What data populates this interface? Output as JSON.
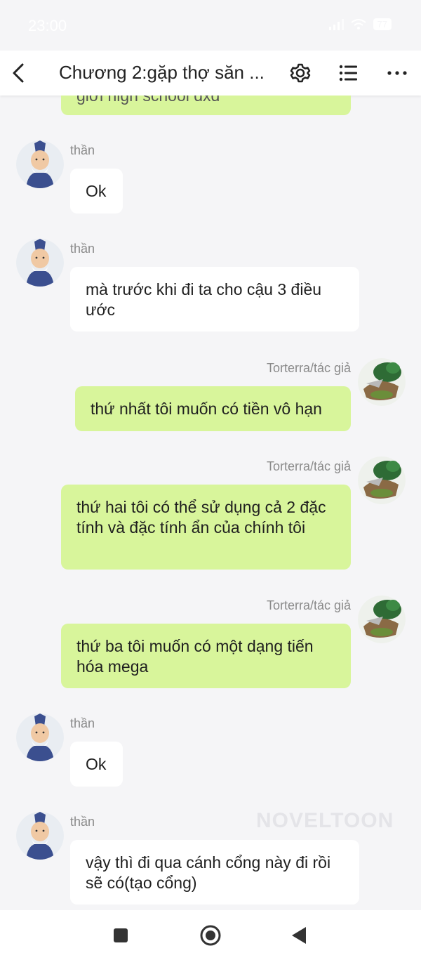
{
  "status": {
    "time": "23:00",
    "battery": "77"
  },
  "header": {
    "title": "Chương 2:gặp thợ săn ..."
  },
  "partial_top": {
    "text": "giới high school dxd"
  },
  "messages": [
    {
      "side": "left",
      "name": "thần",
      "text": "Ok"
    },
    {
      "side": "left",
      "name": "thần",
      "text": "mà trước khi đi ta cho cậu 3 điều ước"
    },
    {
      "side": "right",
      "name": "Torterra/tác giả",
      "text": "thứ nhất tôi muốn có tiền vô hạn"
    },
    {
      "side": "right",
      "name": "Torterra/tác giả",
      "text": "thứ hai tôi có thể sử dụng cả 2 đặc tính và đặc tính ẩn của chính tôi"
    },
    {
      "side": "right",
      "name": "Torterra/tác giả",
      "text": "thứ ba tôi muốn có một dạng tiến hóa mega"
    },
    {
      "side": "left",
      "name": "thần",
      "text": "Ok"
    },
    {
      "side": "left",
      "name": "thần",
      "text": "vậy thì đi qua cánh cổng này đi rồi sẽ có(tạo cổng)"
    }
  ],
  "watermark": "NOVELTOON",
  "colors": {
    "right_bubble": "#d8f59b",
    "left_bubble": "#ffffff",
    "background": "#f5f5f7"
  }
}
